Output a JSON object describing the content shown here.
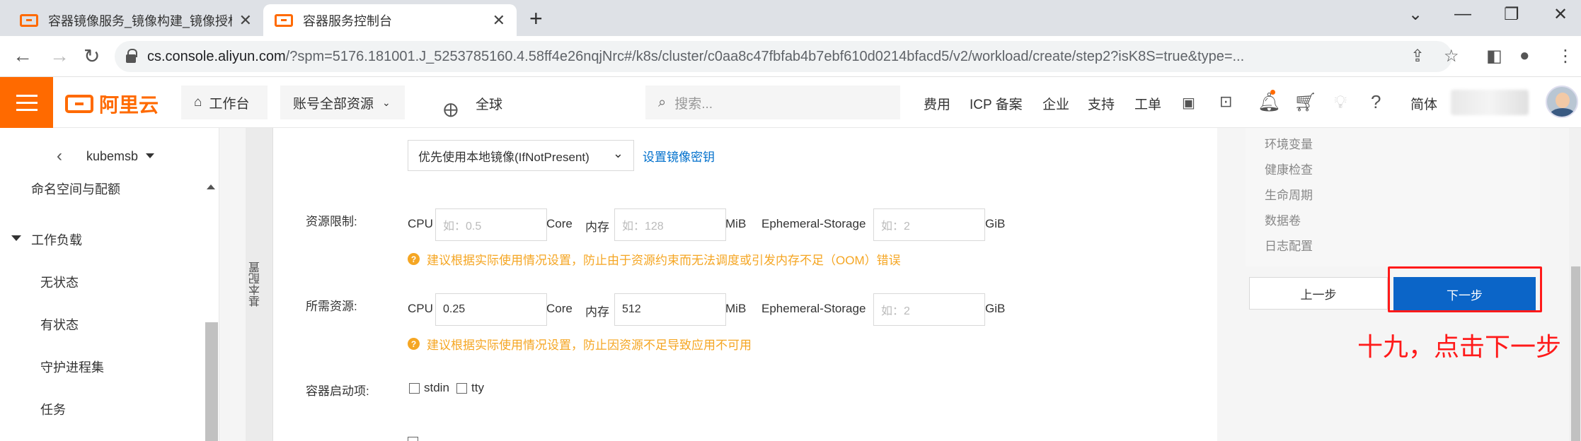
{
  "browser": {
    "tabs": [
      {
        "title": "容器镜像服务_镜像构建_镜像授权",
        "active": false
      },
      {
        "title": "容器服务控制台",
        "active": true
      }
    ],
    "new_tab": "+",
    "window_controls": {
      "minimize": "—",
      "restore": "❐",
      "close": "✕",
      "tabsearch": "⌄"
    },
    "url_domain": "cs.console.aliyun.com",
    "url_path": "/?spm=5176.181001.J_5253785160.4.58ff4e26nqjNrc#/k8s/cluster/c0aa8c47fbfab4b7ebf610d0214bfacd5/v2/workload/create/step2?isK8S=true&type=..."
  },
  "header": {
    "logo_text": "阿里云",
    "workbench": "工作台",
    "account_resources": "账号全部资源",
    "region": "全球",
    "search_placeholder": "搜索...",
    "links": [
      "费用",
      "ICP 备案",
      "企业",
      "支持",
      "工单"
    ],
    "lang": "简体"
  },
  "sidebar": {
    "cluster_name": "kubemsb",
    "items": {
      "namespace": "命名空间与配额",
      "workloads": "工作负载",
      "stateless": "无状态",
      "stateful": "有状态",
      "daemonset": "守护进程集",
      "job": "任务"
    }
  },
  "main": {
    "vertical_tab": "基本配置",
    "pull_policy": "优先使用本地镜像(IfNotPresent)",
    "set_image_secret": "设置镜像密钥",
    "resource_limit": {
      "label": "资源限制:",
      "cpu_label": "CPU",
      "cpu_placeholder": "如：0.5",
      "cpu_unit": "Core",
      "mem_label": "内存",
      "mem_placeholder": "如：128",
      "mem_unit": "MiB",
      "eph_label": "Ephemeral-Storage",
      "eph_placeholder": "如：2",
      "eph_unit": "GiB",
      "warning": "建议根据实际使用情况设置，防止由于资源约束而无法调度或引发内存不足（OOM）错误"
    },
    "resource_request": {
      "label": "所需资源:",
      "cpu_label": "CPU",
      "cpu_value": "0.25",
      "cpu_unit": "Core",
      "mem_label": "内存",
      "mem_value": "512",
      "mem_unit": "MiB",
      "eph_label": "Ephemeral-Storage",
      "eph_placeholder": "如：2",
      "eph_unit": "GiB",
      "warning": "建议根据实际使用情况设置，防止因资源不足导致应用不可用"
    },
    "startup": {
      "label": "容器启动项:",
      "stdin": "stdin",
      "tty": "tty"
    }
  },
  "right_panel": {
    "items": [
      "环境变量",
      "健康检查",
      "生命周期",
      "数据卷",
      "日志配置"
    ],
    "prev_button": "上一步",
    "next_button": "下一步"
  },
  "annotation": "十九，点击下一步",
  "colors": {
    "brand": "#ff6a00",
    "primary": "#0b65c8",
    "warning": "#f5a623",
    "annotation": "#ff1a1a"
  }
}
